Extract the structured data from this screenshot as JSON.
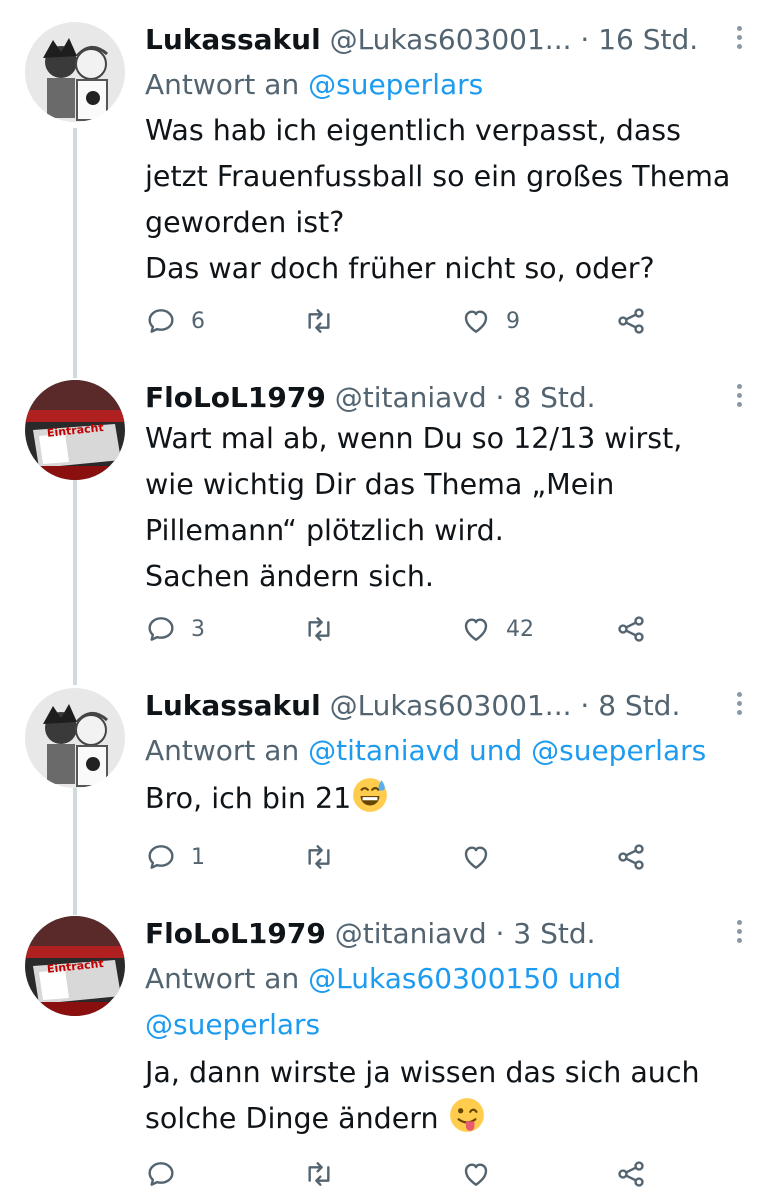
{
  "tweets": [
    {
      "name": "Lukassakul",
      "handle": "@Lukas603001...",
      "dot": "·",
      "time": "16 Std.",
      "reply_prefix": "Antwort an",
      "reply_mentions": "@sueperlars",
      "lines": [
        "Was hab ich eigentlich verpasst, dass",
        "jetzt Frauenfussball so ein großes Thema",
        "geworden ist?",
        "Das war doch früher nicht so, oder?"
      ],
      "counts": {
        "reply": "6",
        "retweet": "",
        "like": "9"
      },
      "avatar": "manga-sketch-avatar"
    },
    {
      "name": "FloLoL1979",
      "handle": "@titaniavd",
      "dot": "·",
      "time": "8 Std.",
      "lines": [
        "Wart mal ab, wenn Du so 12/13 wirst,",
        "wie wichtig Dir das Thema „Mein",
        "Pillemann“ plötzlich wird.",
        "Sachen ändern sich."
      ],
      "counts": {
        "reply": "3",
        "retweet": "",
        "like": "42"
      },
      "avatar": "stadium-choreo-avatar",
      "avatar_text": "Eintracht"
    },
    {
      "name": "Lukassakul",
      "handle": "@Lukas603001...",
      "dot": "·",
      "time": "8 Std.",
      "reply_prefix": "Antwort an",
      "reply_mentions": "@titaniavd und @sueperlars",
      "lines": [
        "Bro, ich bin 21"
      ],
      "emoji": "grinning-sweat-emoji",
      "counts": {
        "reply": "1",
        "retweet": "",
        "like": ""
      },
      "avatar": "manga-sketch-avatar"
    },
    {
      "name": "FloLoL1979",
      "handle": "@titaniavd",
      "dot": "·",
      "time": "3 Std.",
      "reply_prefix": "Antwort an",
      "reply_mentions_line1": "@Lukas60300150 und",
      "reply_mentions_line2": "@sueperlars",
      "lines": [
        "Ja, dann wirste ja wissen das sich auch",
        "solche Dinge ändern"
      ],
      "emoji": "winking-tongue-emoji",
      "counts": {
        "reply": "",
        "retweet": "",
        "like": ""
      },
      "avatar": "stadium-choreo-avatar",
      "avatar_text": "Eintracht"
    }
  ],
  "icons": [
    "reply-icon",
    "retweet-icon",
    "like-icon",
    "share-icon",
    "more-icon"
  ],
  "colors": {
    "text": "#0f1419",
    "secondary": "#536471",
    "link": "#1d9bf0",
    "thread": "#cfd9de"
  }
}
